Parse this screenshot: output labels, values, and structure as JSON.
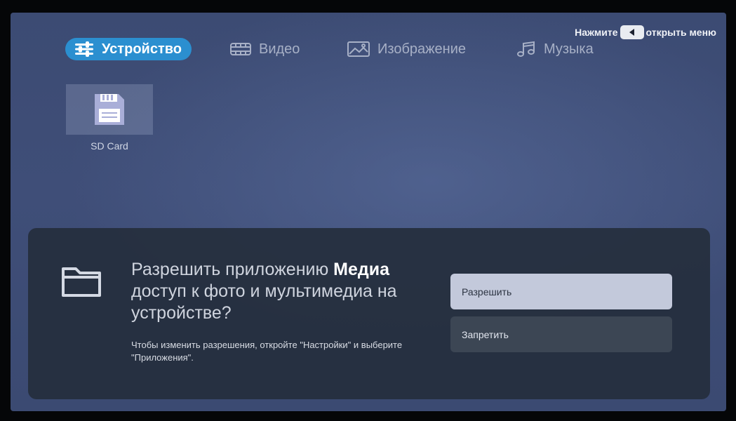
{
  "header": {
    "menu_hint_prefix": "Нажмите",
    "menu_hint_suffix": "открыть меню",
    "menu_key_icon": "left-arrow-key-icon"
  },
  "tabs": [
    {
      "label": "Устройство",
      "icon": "sliders-icon",
      "active": true
    },
    {
      "label": "Видео",
      "icon": "film-icon",
      "active": false
    },
    {
      "label": "Изображение",
      "icon": "image-icon",
      "active": false
    },
    {
      "label": "Музыка",
      "icon": "music-note-icon",
      "active": false
    }
  ],
  "devices": [
    {
      "label": "SD Card",
      "icon": "sd-card-icon"
    }
  ],
  "dialog": {
    "icon": "folder-icon",
    "title_prefix": "Разрешить приложению ",
    "title_app": "Медиа",
    "title_suffix": " доступ к фото и мультимедиа на устройстве?",
    "hint": "Чтобы изменить разрешения, откройте \"Настройки\" и выберите \"Приложения\".",
    "allow_label": "Разрешить",
    "deny_label": "Запретить"
  },
  "colors": {
    "background": "#3d4c75",
    "accent_tab": "#2b8fd0",
    "dialog_bg": "#252f3e",
    "allow_button": "#c3c9db",
    "deny_button": "#3c4654"
  }
}
